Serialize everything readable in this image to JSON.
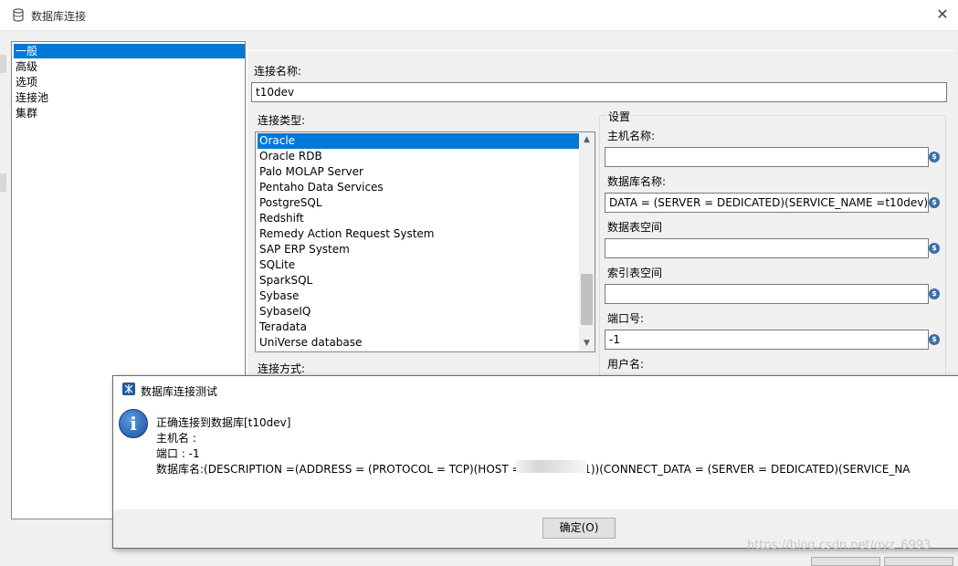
{
  "window": {
    "title": "数据库连接",
    "close_icon": "close-icon"
  },
  "nav": {
    "items": [
      {
        "label": "一般",
        "selected": true
      },
      {
        "label": "高级",
        "selected": false
      },
      {
        "label": "选项",
        "selected": false
      },
      {
        "label": "连接池",
        "selected": false
      },
      {
        "label": "集群",
        "selected": false
      }
    ]
  },
  "form": {
    "connection_name_label": "连接名称:",
    "connection_name_value": "t10dev",
    "connection_type_label": "连接类型:",
    "connection_types": [
      {
        "label": "Oracle",
        "selected": true
      },
      {
        "label": "Oracle RDB",
        "selected": false
      },
      {
        "label": "Palo MOLAP Server",
        "selected": false
      },
      {
        "label": "Pentaho Data Services",
        "selected": false
      },
      {
        "label": "PostgreSQL",
        "selected": false
      },
      {
        "label": "Redshift",
        "selected": false
      },
      {
        "label": "Remedy Action Request System",
        "selected": false
      },
      {
        "label": "SAP ERP System",
        "selected": false
      },
      {
        "label": "SQLite",
        "selected": false
      },
      {
        "label": "SparkSQL",
        "selected": false
      },
      {
        "label": "Sybase",
        "selected": false
      },
      {
        "label": "SybaseIQ",
        "selected": false
      },
      {
        "label": "Teradata",
        "selected": false
      },
      {
        "label": "UniVerse database",
        "selected": false
      }
    ],
    "access_label": "连接方式:"
  },
  "settings": {
    "group_label": "设置",
    "host_label": "主机名称:",
    "host_value": "",
    "db_label": "数据库名称:",
    "db_value": "DATA = (SERVER = DEDICATED)(SERVICE_NAME =t10dev)))",
    "tablespace_label": "数据表空间",
    "tablespace_value": "",
    "index_tablespace_label": "索引表空间",
    "index_tablespace_value": "",
    "port_label": "端口号:",
    "port_value": "-1",
    "user_label": "用户名:"
  },
  "dialog": {
    "title": "数据库连接测试",
    "line1": "正确连接到数据库[t10dev]",
    "line2": "主机名        :",
    "line3": "端口          : -1",
    "line4": "数据库名:(DESCRIPTION =(ADDRESS = (PROTOCOL = TCP)(HOST =                    ORT = 1521))(CONNECT_DATA = (SERVER = DEDICATED)(SERVICE_NA",
    "ok_label": "确定(O)",
    "icon": "info-icon"
  },
  "watermark": "https://blog.csdn.net/gyz_6993"
}
